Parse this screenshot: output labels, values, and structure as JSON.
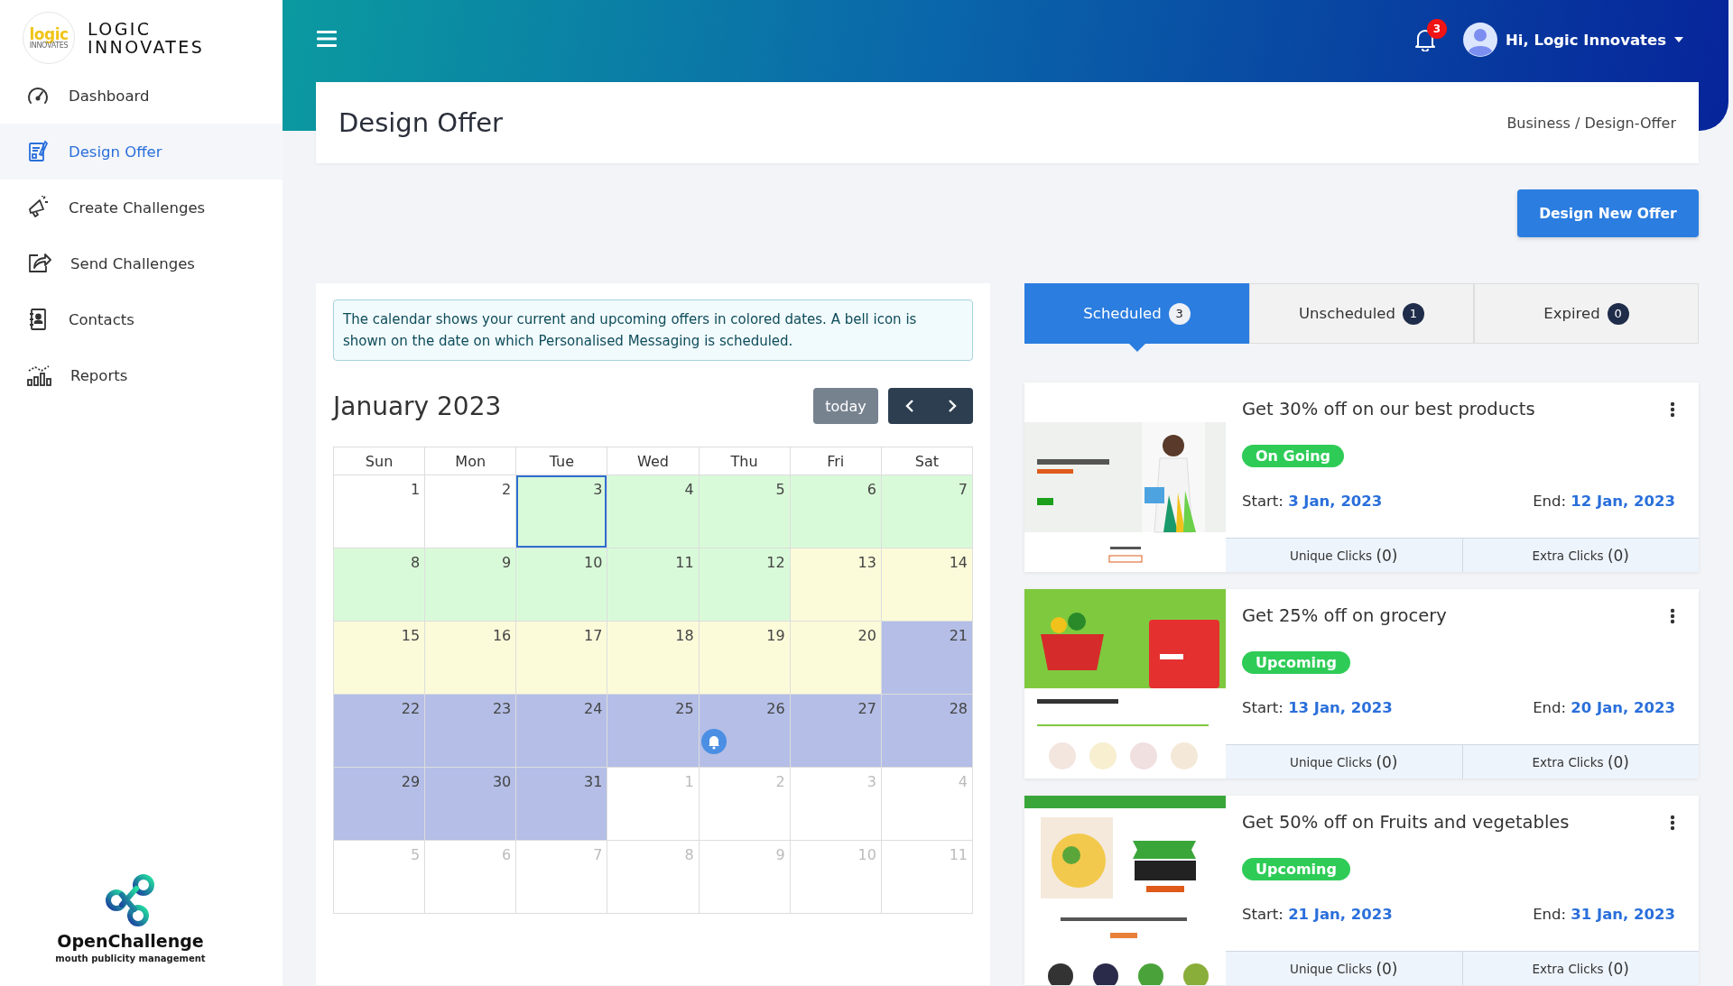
{
  "sidebar": {
    "logo": {
      "mark": "logic",
      "mark_small": "INNOVATES",
      "name_line1": "LOGIC",
      "name_line2": "INNOVATES"
    },
    "items": [
      {
        "label": "Dashboard",
        "selected": false
      },
      {
        "label": "Design Offer",
        "selected": true
      },
      {
        "label": "Create Challenges",
        "selected": false
      },
      {
        "label": "Send Challenges",
        "selected": false
      },
      {
        "label": "Contacts",
        "selected": false
      },
      {
        "label": "Reports",
        "selected": false
      }
    ],
    "brand": {
      "name": "OpenChallenge",
      "tagline": "mouth publicity management"
    }
  },
  "header": {
    "notifications": "3",
    "user": "Hi, Logic Innovates"
  },
  "page": {
    "title": "Design Offer",
    "breadcrumb": "Business / Design-Offer",
    "action": "Design New Offer"
  },
  "calendar": {
    "info": "The calendar shows your current and upcoming offers in colored dates. A bell icon is shown on the date on which Personalised Messaging is scheduled.",
    "month": "January 2023",
    "today_button": "today",
    "weekdays": [
      "Sun",
      "Mon",
      "Tue",
      "Wed",
      "Thu",
      "Fri",
      "Sat"
    ],
    "weeks": [
      [
        {
          "day": "1",
          "other_month": false,
          "today": false,
          "bell": false
        },
        {
          "day": "2",
          "other_month": false,
          "today": false,
          "bell": false
        },
        {
          "day": "3",
          "other_month": false,
          "today": true,
          "bell": false,
          "color": "#d9fad9"
        },
        {
          "day": "4",
          "other_month": false,
          "today": false,
          "bell": false,
          "color": "#d9fad9"
        },
        {
          "day": "5",
          "other_month": false,
          "today": false,
          "bell": false,
          "color": "#d9fad9"
        },
        {
          "day": "6",
          "other_month": false,
          "today": false,
          "bell": false,
          "color": "#d9fad9"
        },
        {
          "day": "7",
          "other_month": false,
          "today": false,
          "bell": false,
          "color": "#d9fad9"
        }
      ],
      [
        {
          "day": "8",
          "other_month": false,
          "today": false,
          "bell": false,
          "color": "#d9fad9"
        },
        {
          "day": "9",
          "other_month": false,
          "today": false,
          "bell": false,
          "color": "#d9fad9"
        },
        {
          "day": "10",
          "other_month": false,
          "today": false,
          "bell": false,
          "color": "#d9fad9"
        },
        {
          "day": "11",
          "other_month": false,
          "today": false,
          "bell": false,
          "color": "#d9fad9"
        },
        {
          "day": "12",
          "other_month": false,
          "today": false,
          "bell": false,
          "color": "#d9fad9"
        },
        {
          "day": "13",
          "other_month": false,
          "today": false,
          "bell": false,
          "color": "#fbfbda"
        },
        {
          "day": "14",
          "other_month": false,
          "today": false,
          "bell": false,
          "color": "#fbfbda"
        }
      ],
      [
        {
          "day": "15",
          "other_month": false,
          "today": false,
          "bell": false,
          "color": "#fbfbda"
        },
        {
          "day": "16",
          "other_month": false,
          "today": false,
          "bell": false,
          "color": "#fbfbda"
        },
        {
          "day": "17",
          "other_month": false,
          "today": false,
          "bell": false,
          "color": "#fbfbda"
        },
        {
          "day": "18",
          "other_month": false,
          "today": false,
          "bell": false,
          "color": "#fbfbda"
        },
        {
          "day": "19",
          "other_month": false,
          "today": false,
          "bell": false,
          "color": "#fbfbda"
        },
        {
          "day": "20",
          "other_month": false,
          "today": false,
          "bell": false,
          "color": "#fbfbda"
        },
        {
          "day": "21",
          "other_month": false,
          "today": false,
          "bell": false,
          "color": "#b4bee6"
        }
      ],
      [
        {
          "day": "22",
          "other_month": false,
          "today": false,
          "bell": false,
          "color": "#b4bee6"
        },
        {
          "day": "23",
          "other_month": false,
          "today": false,
          "bell": false,
          "color": "#b4bee6"
        },
        {
          "day": "24",
          "other_month": false,
          "today": false,
          "bell": false,
          "color": "#b4bee6"
        },
        {
          "day": "25",
          "other_month": false,
          "today": false,
          "bell": false,
          "color": "#b4bee6"
        },
        {
          "day": "26",
          "other_month": false,
          "today": false,
          "bell": true,
          "color": "#b4bee6"
        },
        {
          "day": "27",
          "other_month": false,
          "today": false,
          "bell": false,
          "color": "#b4bee6"
        },
        {
          "day": "28",
          "other_month": false,
          "today": false,
          "bell": false,
          "color": "#b4bee6"
        }
      ],
      [
        {
          "day": "29",
          "other_month": false,
          "today": false,
          "bell": false,
          "color": "#b4bee6"
        },
        {
          "day": "30",
          "other_month": false,
          "today": false,
          "bell": false,
          "color": "#b4bee6"
        },
        {
          "day": "31",
          "other_month": false,
          "today": false,
          "bell": false,
          "color": "#b4bee6"
        },
        {
          "day": "1",
          "other_month": true,
          "today": false,
          "bell": false
        },
        {
          "day": "2",
          "other_month": true,
          "today": false,
          "bell": false
        },
        {
          "day": "3",
          "other_month": true,
          "today": false,
          "bell": false
        },
        {
          "day": "4",
          "other_month": true,
          "today": false,
          "bell": false
        }
      ],
      [
        {
          "day": "5",
          "other_month": true,
          "today": false,
          "bell": false
        },
        {
          "day": "6",
          "other_month": true,
          "today": false,
          "bell": false
        },
        {
          "day": "7",
          "other_month": true,
          "today": false,
          "bell": false
        },
        {
          "day": "8",
          "other_month": true,
          "today": false,
          "bell": false
        },
        {
          "day": "9",
          "other_month": true,
          "today": false,
          "bell": false
        },
        {
          "day": "10",
          "other_month": true,
          "today": false,
          "bell": false
        },
        {
          "day": "11",
          "other_month": true,
          "today": false,
          "bell": false
        }
      ]
    ]
  },
  "tabs": [
    {
      "label": "Scheduled",
      "count": "3",
      "selected": true
    },
    {
      "label": "Unscheduled",
      "count": "1",
      "selected": false
    },
    {
      "label": "Expired",
      "count": "0",
      "selected": false
    }
  ],
  "offers": [
    {
      "title": "Get 30% off on our best products",
      "status": "On Going",
      "start_label": "Start:",
      "start": "3 Jan, 2023",
      "end_label": "End:",
      "end": "12 Jan, 2023",
      "unique_label": "Unique Clicks",
      "unique": "(0)",
      "extra_label": "Extra Clicks",
      "extra": "(0)"
    },
    {
      "title": "Get 25% off on grocery",
      "status": "Upcoming",
      "start_label": "Start:",
      "start": "13 Jan, 2023",
      "end_label": "End:",
      "end": "20 Jan, 2023",
      "unique_label": "Unique Clicks",
      "unique": "(0)",
      "extra_label": "Extra Clicks",
      "extra": "(0)"
    },
    {
      "title": "Get 50% off on Fruits and vegetables",
      "status": "Upcoming",
      "start_label": "Start:",
      "start": "21 Jan, 2023",
      "end_label": "End:",
      "end": "31 Jan, 2023",
      "unique_label": "Unique Clicks",
      "unique": "(0)",
      "extra_label": "Extra Clicks",
      "extra": "(0)"
    }
  ]
}
